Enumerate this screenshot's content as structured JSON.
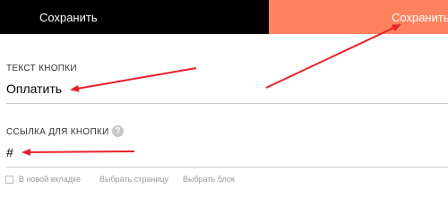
{
  "toolbar": {
    "save_dark_label": "Сохранить",
    "save_accent_label": "Сохранить"
  },
  "form": {
    "button_text": {
      "label": "ТЕКСТ КНОПКИ",
      "value": "Оплатить"
    },
    "button_link": {
      "label": "ССЫЛКА ДЛЯ КНОПКИ",
      "help_glyph": "?",
      "value": "#"
    },
    "options": {
      "new_tab_label": "В новой вкладке",
      "choose_page_label": "Выбрать страницу",
      "choose_block_label": "Выбрать блок",
      "new_tab_checked": false
    }
  },
  "colors": {
    "dark_button": "#000000",
    "accent_button": "#ff825f",
    "annotation_arrows": "#e8202a",
    "muted_text": "#9a9a9a"
  }
}
